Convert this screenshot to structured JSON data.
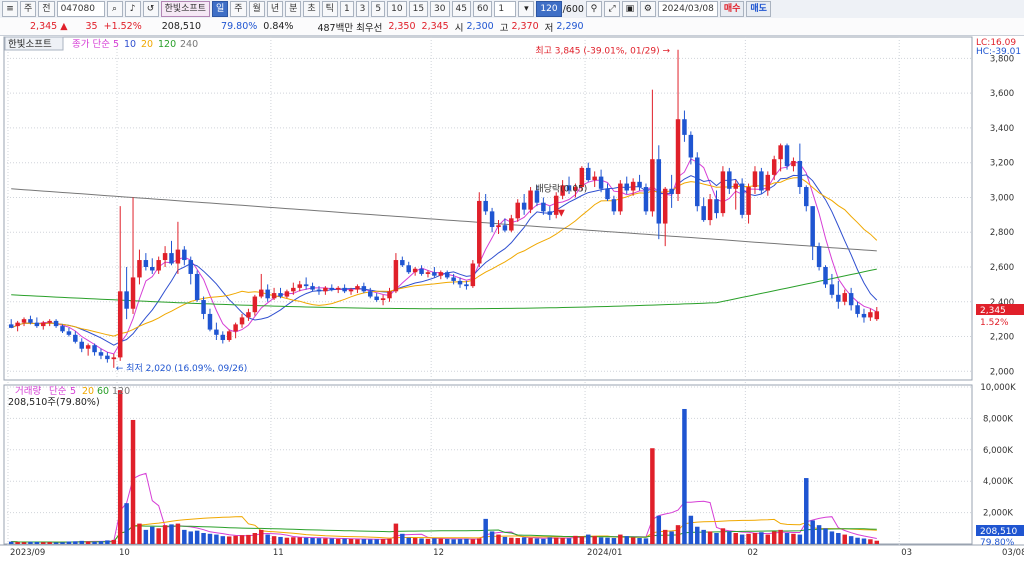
{
  "toolbar": {
    "menu_icon": "menu-icon",
    "item_code_prefix": "주",
    "item_code_type": "전",
    "code": "047080",
    "stock_name": "한빛소프트",
    "periods": [
      "일",
      "주",
      "월",
      "년",
      "분",
      "초",
      "틱"
    ],
    "active_period": "일",
    "intervals": [
      "1",
      "3",
      "5",
      "10",
      "15",
      "30",
      "45",
      "60"
    ],
    "count_value": "1",
    "view_count": "120",
    "view_total": "/600",
    "date": "2024/03/08",
    "buy_label": "매수",
    "sell_label": "매도"
  },
  "info": {
    "price": "2,345",
    "change": "35",
    "change_pct": "+1.52%",
    "volume": "208,510",
    "volume_ratio": "79.80%",
    "turnover": "0.84%",
    "trade_value": "487백만",
    "best_ask_label": "최우선",
    "best_ask": "2,350",
    "best_bid": "2,345",
    "open_label": "시",
    "open": "2,300",
    "high_label": "고",
    "high": "2,370",
    "low_label": "저",
    "low": "2,290"
  },
  "price_panel": {
    "title": "한빛소프트",
    "ma_label": "종가 단순",
    "ma_periods": [
      "5",
      "10",
      "20",
      "120",
      "240"
    ],
    "top_right_lc": "LC:16.09",
    "top_right_hc": "HC:-39.01",
    "high_note": "최고 3,845 (-39.01%, 01/29)",
    "low_note": "최저 2,020 (16.09%, 09/26)",
    "dividend_note": "배당락(0.05)",
    "current_price": "2,345",
    "current_pct": "1.52%"
  },
  "volume_panel": {
    "title": "거래량",
    "ma_label": "단순",
    "ma_periods": [
      "5",
      "20",
      "60",
      "120"
    ],
    "current_volume_text": "208,510주(79.80%)",
    "current_volume": "208,510",
    "current_pct": "79.80%"
  },
  "colors": {
    "up": "#e0202a",
    "down": "#1f55d1",
    "ma5": "#d63fd6",
    "ma10": "#3050d0",
    "ma20": "#f0a800",
    "ma120": "#2aa02a",
    "ma240": "#777777"
  },
  "chart_data": [
    {
      "type": "candlestick",
      "title": "한빛소프트",
      "ylim": [
        1950,
        3900
      ],
      "y_ticks": [
        "2,000",
        "2,200",
        "2,400",
        "2,600",
        "2,800",
        "3,000",
        "3,200",
        "3,400",
        "3,600",
        "3,800"
      ],
      "y_tick_values": [
        2000,
        2200,
        2400,
        2600,
        2800,
        3000,
        3200,
        3400,
        3600,
        3800
      ],
      "x_labels": [
        "2023/09",
        "10",
        "11",
        "12",
        "2024/01",
        "02",
        "03",
        "03/08"
      ],
      "x_label_index": [
        0,
        17,
        41,
        66,
        90,
        115,
        139,
        142
      ],
      "candles": [
        [
          2270,
          2300,
          2250,
          2250
        ],
        [
          2260,
          2290,
          2230,
          2280
        ],
        [
          2280,
          2310,
          2260,
          2300
        ],
        [
          2300,
          2320,
          2270,
          2280
        ],
        [
          2280,
          2310,
          2250,
          2260
        ],
        [
          2260,
          2290,
          2240,
          2280
        ],
        [
          2280,
          2300,
          2260,
          2290
        ],
        [
          2290,
          2300,
          2250,
          2260
        ],
        [
          2260,
          2270,
          2220,
          2230
        ],
        [
          2230,
          2250,
          2200,
          2210
        ],
        [
          2210,
          2230,
          2160,
          2170
        ],
        [
          2170,
          2190,
          2110,
          2130
        ],
        [
          2130,
          2160,
          2090,
          2150
        ],
        [
          2150,
          2160,
          2090,
          2110
        ],
        [
          2110,
          2130,
          2070,
          2090
        ],
        [
          2090,
          2110,
          2050,
          2070
        ],
        [
          2070,
          2100,
          2020,
          2080
        ],
        [
          2080,
          2950,
          2060,
          2460
        ],
        [
          2460,
          2600,
          2300,
          2360
        ],
        [
          2360,
          3000,
          2330,
          2540
        ],
        [
          2540,
          2700,
          2500,
          2640
        ],
        [
          2640,
          2680,
          2580,
          2600
        ],
        [
          2600,
          2650,
          2560,
          2580
        ],
        [
          2580,
          2660,
          2560,
          2640
        ],
        [
          2640,
          2720,
          2600,
          2680
        ],
        [
          2680,
          2750,
          2610,
          2620
        ],
        [
          2620,
          2860,
          2560,
          2700
        ],
        [
          2700,
          2720,
          2610,
          2640
        ],
        [
          2640,
          2660,
          2500,
          2560
        ],
        [
          2560,
          2580,
          2400,
          2410
        ],
        [
          2410,
          2430,
          2300,
          2330
        ],
        [
          2330,
          2360,
          2230,
          2240
        ],
        [
          2240,
          2280,
          2180,
          2210
        ],
        [
          2210,
          2230,
          2160,
          2180
        ],
        [
          2180,
          2240,
          2170,
          2230
        ],
        [
          2230,
          2280,
          2190,
          2270
        ],
        [
          2270,
          2330,
          2250,
          2310
        ],
        [
          2310,
          2360,
          2290,
          2340
        ],
        [
          2340,
          2440,
          2320,
          2430
        ],
        [
          2430,
          2560,
          2420,
          2470
        ],
        [
          2470,
          2500,
          2400,
          2420
        ],
        [
          2420,
          2480,
          2410,
          2450
        ],
        [
          2450,
          2480,
          2420,
          2430
        ],
        [
          2430,
          2470,
          2420,
          2460
        ],
        [
          2460,
          2510,
          2440,
          2480
        ],
        [
          2480,
          2520,
          2460,
          2500
        ],
        [
          2500,
          2540,
          2470,
          2490
        ],
        [
          2490,
          2510,
          2460,
          2470
        ],
        [
          2470,
          2490,
          2440,
          2460
        ],
        [
          2460,
          2490,
          2440,
          2480
        ],
        [
          2480,
          2500,
          2460,
          2470
        ],
        [
          2470,
          2490,
          2450,
          2480
        ],
        [
          2480,
          2500,
          2450,
          2460
        ],
        [
          2460,
          2480,
          2440,
          2470
        ],
        [
          2470,
          2500,
          2450,
          2490
        ],
        [
          2490,
          2510,
          2450,
          2460
        ],
        [
          2460,
          2480,
          2420,
          2430
        ],
        [
          2430,
          2450,
          2400,
          2410
        ],
        [
          2410,
          2440,
          2380,
          2420
        ],
        [
          2420,
          2480,
          2400,
          2460
        ],
        [
          2460,
          2680,
          2450,
          2640
        ],
        [
          2640,
          2660,
          2600,
          2610
        ],
        [
          2610,
          2630,
          2560,
          2570
        ],
        [
          2570,
          2600,
          2550,
          2590
        ],
        [
          2590,
          2610,
          2550,
          2560
        ],
        [
          2560,
          2580,
          2540,
          2570
        ],
        [
          2570,
          2600,
          2540,
          2550
        ],
        [
          2550,
          2580,
          2530,
          2570
        ],
        [
          2570,
          2580,
          2530,
          2540
        ],
        [
          2540,
          2560,
          2500,
          2520
        ],
        [
          2520,
          2540,
          2480,
          2500
        ],
        [
          2500,
          2520,
          2470,
          2490
        ],
        [
          2490,
          2640,
          2480,
          2620
        ],
        [
          2620,
          3030,
          2600,
          2980
        ],
        [
          2980,
          3020,
          2900,
          2920
        ],
        [
          2920,
          2940,
          2800,
          2830
        ],
        [
          2830,
          2870,
          2790,
          2840
        ],
        [
          2840,
          2880,
          2800,
          2810
        ],
        [
          2810,
          2900,
          2800,
          2880
        ],
        [
          2880,
          2990,
          2860,
          2970
        ],
        [
          2970,
          3020,
          2900,
          2930
        ],
        [
          2930,
          3060,
          2910,
          3040
        ],
        [
          3040,
          3070,
          2950,
          2970
        ],
        [
          2970,
          3000,
          2900,
          2920
        ],
        [
          2920,
          2950,
          2870,
          2900
        ],
        [
          2900,
          3030,
          2880,
          3010
        ],
        [
          3010,
          3100,
          2990,
          3070
        ],
        [
          3070,
          3120,
          3020,
          3040
        ],
        [
          3040,
          3080,
          3000,
          3060
        ],
        [
          3060,
          3180,
          3040,
          3170
        ],
        [
          3170,
          3200,
          3090,
          3100
        ],
        [
          3100,
          3150,
          3060,
          3120
        ],
        [
          3120,
          3160,
          3030,
          3050
        ],
        [
          3050,
          3080,
          2980,
          2990
        ],
        [
          2990,
          3010,
          2900,
          2920
        ],
        [
          2920,
          3100,
          2900,
          3080
        ],
        [
          3080,
          3120,
          3020,
          3040
        ],
        [
          3040,
          3110,
          3010,
          3090
        ],
        [
          3090,
          3130,
          3040,
          3060
        ],
        [
          3060,
          3080,
          2900,
          2920
        ],
        [
          2920,
          3620,
          2890,
          3220
        ],
        [
          3220,
          3300,
          2760,
          2850
        ],
        [
          2850,
          3060,
          2720,
          3050
        ],
        [
          3050,
          3130,
          2940,
          3020
        ],
        [
          3020,
          3850,
          2980,
          3450
        ],
        [
          3450,
          3500,
          3320,
          3360
        ],
        [
          3360,
          3380,
          3190,
          3230
        ],
        [
          3230,
          3260,
          2920,
          2950
        ],
        [
          2950,
          3000,
          2860,
          2870
        ],
        [
          2870,
          3020,
          2840,
          2990
        ],
        [
          2990,
          3040,
          2880,
          2910
        ],
        [
          2910,
          3180,
          2890,
          3150
        ],
        [
          3150,
          3170,
          3020,
          3050
        ],
        [
          3050,
          3100,
          2930,
          3080
        ],
        [
          3080,
          3110,
          2880,
          2900
        ],
        [
          2900,
          3080,
          2850,
          3060
        ],
        [
          3060,
          3180,
          3020,
          3150
        ],
        [
          3150,
          3170,
          3020,
          3040
        ],
        [
          3040,
          3150,
          3010,
          3130
        ],
        [
          3130,
          3240,
          3100,
          3220
        ],
        [
          3220,
          3310,
          3150,
          3300
        ],
        [
          3300,
          3310,
          3160,
          3180
        ],
        [
          3180,
          3230,
          3150,
          3210
        ],
        [
          3210,
          3310,
          3020,
          3060
        ],
        [
          3060,
          3070,
          2920,
          2950
        ],
        [
          2950,
          2950,
          2640,
          2720
        ],
        [
          2720,
          2740,
          2580,
          2600
        ],
        [
          2600,
          2610,
          2480,
          2500
        ],
        [
          2500,
          2560,
          2420,
          2440
        ],
        [
          2440,
          2520,
          2360,
          2400
        ],
        [
          2400,
          2470,
          2380,
          2450
        ],
        [
          2450,
          2480,
          2350,
          2380
        ],
        [
          2380,
          2400,
          2310,
          2330
        ],
        [
          2330,
          2360,
          2280,
          2310
        ],
        [
          2310,
          2360,
          2290,
          2340
        ],
        [
          2300,
          2370,
          2290,
          2345
        ]
      ],
      "ma_series": [
        {
          "name": "5",
          "period": 5
        },
        {
          "name": "10",
          "period": 10
        },
        {
          "name": "20",
          "period": 20
        },
        {
          "name": "120",
          "period": 120
        },
        {
          "name": "240",
          "period": 240
        }
      ],
      "annotations": [
        {
          "text": "최고 3,845 (-39.01%, 01/29)",
          "index": 104,
          "value": 3845
        },
        {
          "text": "최저 2,020 (16.09%, 09/26)",
          "index": 16,
          "value": 2020
        },
        {
          "text": "배당락(0.05)",
          "index": 83,
          "value": 3000
        }
      ]
    },
    {
      "type": "bar",
      "title": "거래량",
      "ylim": [
        0,
        10000
      ],
      "y_ticks": [
        "2,000K",
        "4,000K",
        "6,000K",
        "8,000K",
        "10,000K"
      ],
      "y_tick_values": [
        2000,
        4000,
        6000,
        8000,
        10000
      ],
      "unit": "K",
      "volumes": [
        150,
        120,
        110,
        140,
        130,
        110,
        120,
        100,
        110,
        160,
        170,
        200,
        150,
        140,
        180,
        230,
        260,
        9800,
        2600,
        7900,
        1300,
        900,
        1100,
        1000,
        1200,
        1250,
        1300,
        900,
        800,
        850,
        700,
        650,
        600,
        500,
        480,
        520,
        560,
        580,
        700,
        900,
        600,
        500,
        450,
        400,
        430,
        420,
        400,
        380,
        370,
        360,
        350,
        330,
        340,
        320,
        300,
        310,
        290,
        300,
        310,
        330,
        1300,
        650,
        400,
        380,
        350,
        330,
        360,
        340,
        320,
        300,
        310,
        330,
        300,
        350,
        1600,
        800,
        600,
        450,
        400,
        380,
        420,
        380,
        350,
        330,
        420,
        400,
        380,
        360,
        520,
        480,
        600,
        500,
        420,
        400,
        380,
        600,
        500,
        420,
        380,
        360,
        6100,
        1800,
        900,
        800,
        1200,
        8600,
        1800,
        1100,
        900,
        800,
        700,
        1000,
        800,
        700,
        600,
        650,
        700,
        750,
        600,
        800,
        900,
        700,
        650,
        600,
        4200,
        1500,
        1200,
        1000,
        800,
        700,
        600,
        500,
        400,
        350,
        300,
        208.51
      ]
    }
  ]
}
